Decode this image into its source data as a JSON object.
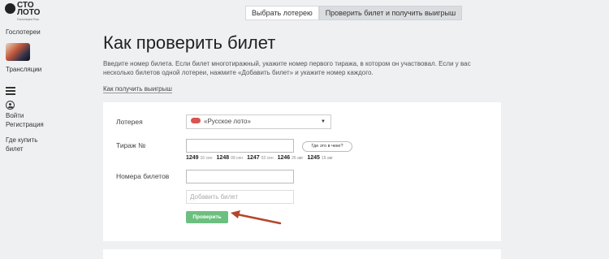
{
  "logo": {
    "line1": "СТО",
    "line2": "ЛОТО",
    "tagline": "Гослотерея Росс"
  },
  "sidebar": {
    "items": [
      {
        "label": "Гослотереи"
      },
      {
        "label": "Трансляции"
      },
      {
        "label": "Войти"
      },
      {
        "label": "Регистрация"
      },
      {
        "label": "Где купить"
      },
      {
        "label": "билет"
      }
    ]
  },
  "toggle": {
    "tab1": "Выбрать лотерею",
    "tab2": "Проверить билет и получить выигрыш",
    "active": "tab2"
  },
  "page": {
    "title": "Как проверить билет",
    "intro": "Введите номер билета. Если билет многотиражный, укажите номер первого тиража, в котором он участвовал. Если у вас несколько билетов одной лотереи, нажмите «Добавить билет» и укажите номер каждого.",
    "howto_link": "Как получить выигрыш"
  },
  "form": {
    "lottery_label": "Лотерея",
    "lottery_value": "«Русское лото»",
    "draw_label": "Тираж №",
    "draw_value": "",
    "help_label": "Где это в чеке?",
    "draws": [
      {
        "num": "1249",
        "date": "16 сен"
      },
      {
        "num": "1248",
        "date": "09 сен"
      },
      {
        "num": "1247",
        "date": "02 сен"
      },
      {
        "num": "1246",
        "date": "26 авг"
      },
      {
        "num": "1245",
        "date": "19 авг"
      }
    ],
    "tickets_label": "Номера билетов",
    "ticket_value": "",
    "add_ticket_placeholder": "Добавить билет",
    "submit_label": "Проверить"
  },
  "colors": {
    "accent": "#6cc07f",
    "arrow": "#b5452b",
    "lottery_chip": "#d9534f"
  }
}
